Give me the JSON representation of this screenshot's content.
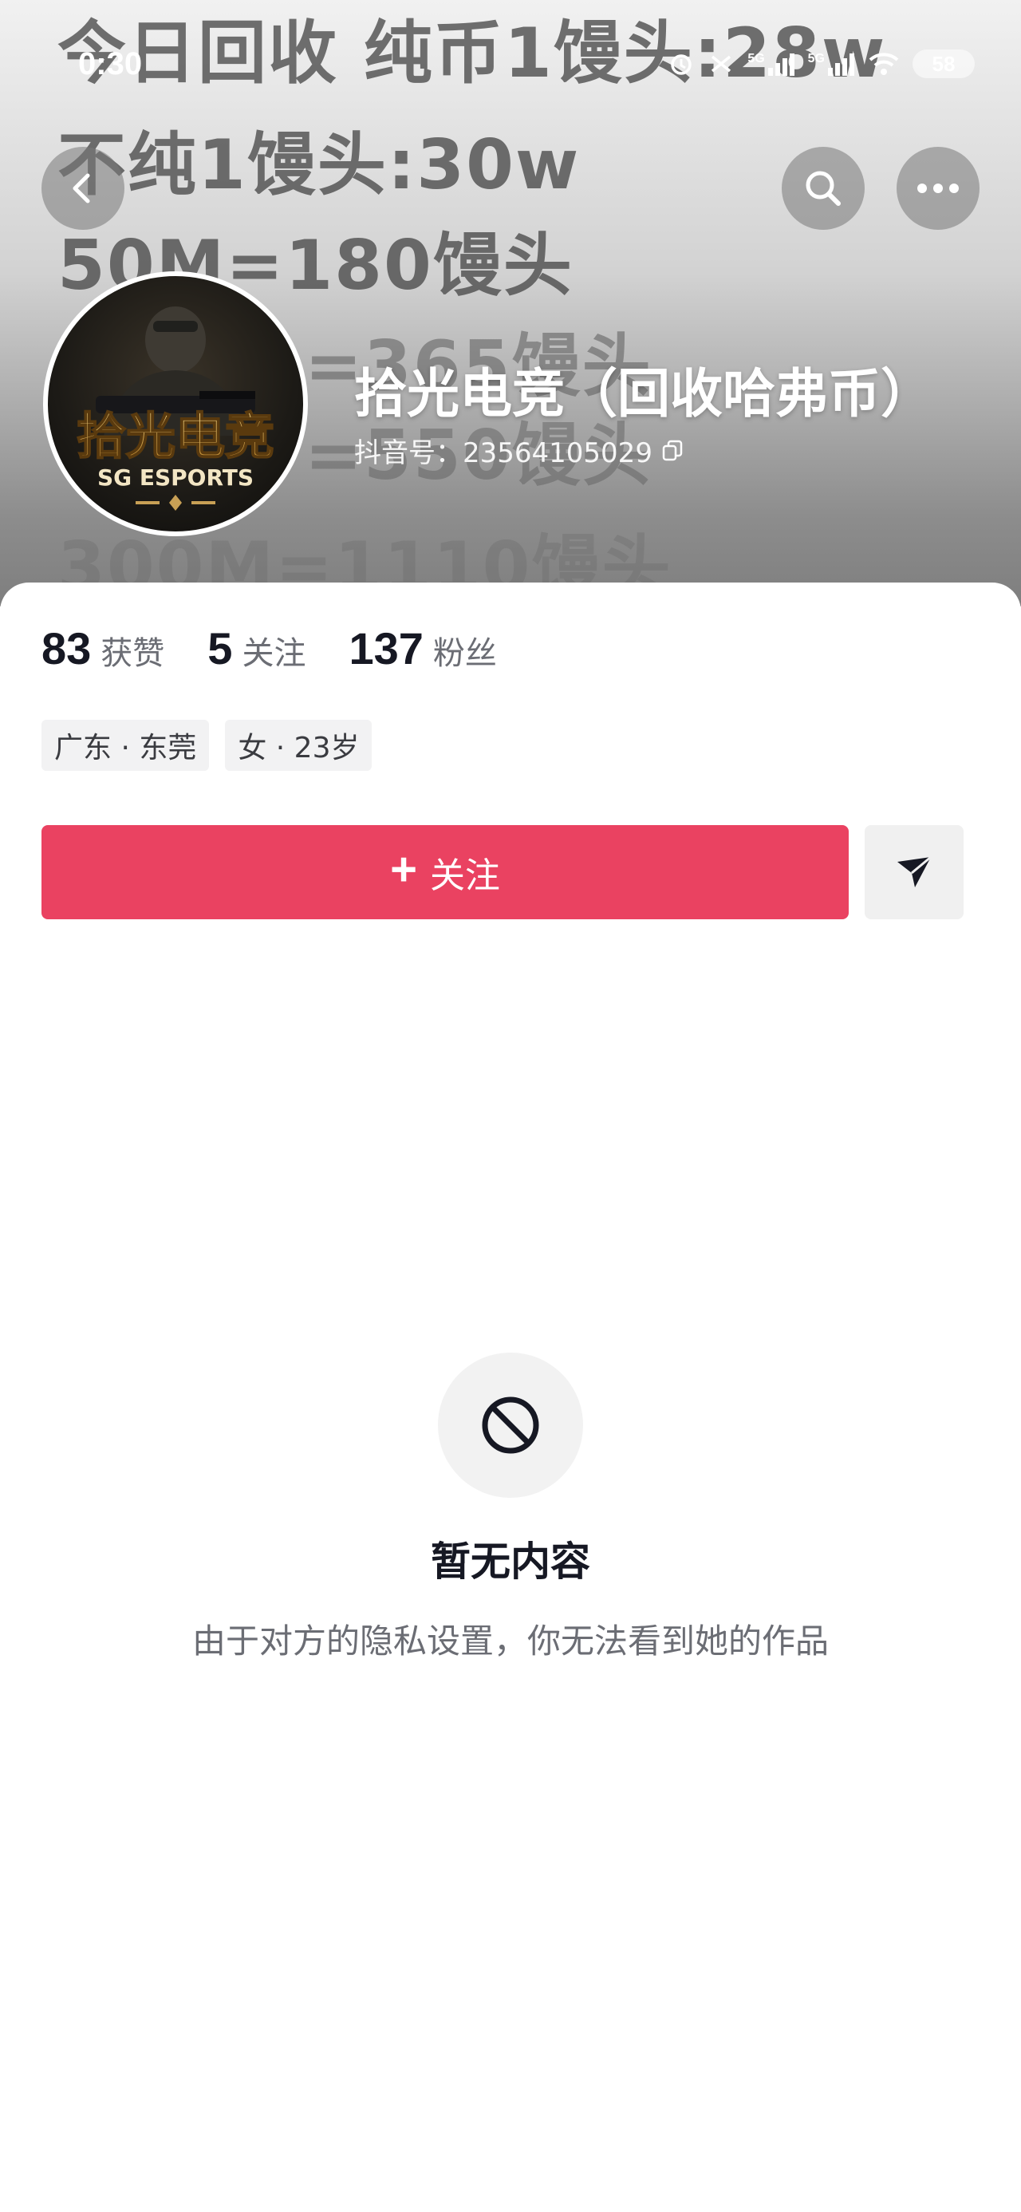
{
  "status_bar": {
    "time": "0:30",
    "network_labels": [
      "5G",
      "5G"
    ],
    "battery": "58"
  },
  "background_image_text": [
    "今日回收   纯币1馒头:28w",
    "不纯1馒头:30w",
    "50M=180馒头",
    "=365馒头",
    "=550馒头",
    "300M=1110馒头"
  ],
  "header": {
    "back_icon": "chevron-left-icon",
    "search_icon": "search-icon",
    "more_icon": "more-horizontal-icon"
  },
  "avatar": {
    "logo_title": "拾光电竞",
    "logo_subtitle": "SG ESPORTS"
  },
  "profile": {
    "name": "拾光电竞（回收哈弗币）",
    "douyin_id": "抖音号：23564105029"
  },
  "stats": [
    {
      "value": "83",
      "label": "获赞"
    },
    {
      "value": "5",
      "label": "关注"
    },
    {
      "value": "137",
      "label": "粉丝"
    }
  ],
  "tags": [
    "广东 · 东莞",
    "女 · 23岁"
  ],
  "actions": {
    "follow_label": "关注",
    "share_icon": "send-icon"
  },
  "empty_state": {
    "icon": "forbidden-icon",
    "title": "暂无内容",
    "subtitle": "由于对方的隐私设置，你无法看到她的作品"
  },
  "colors": {
    "accent": "#ea4261",
    "text_primary": "#161823",
    "text_secondary": "#6b6d74"
  }
}
